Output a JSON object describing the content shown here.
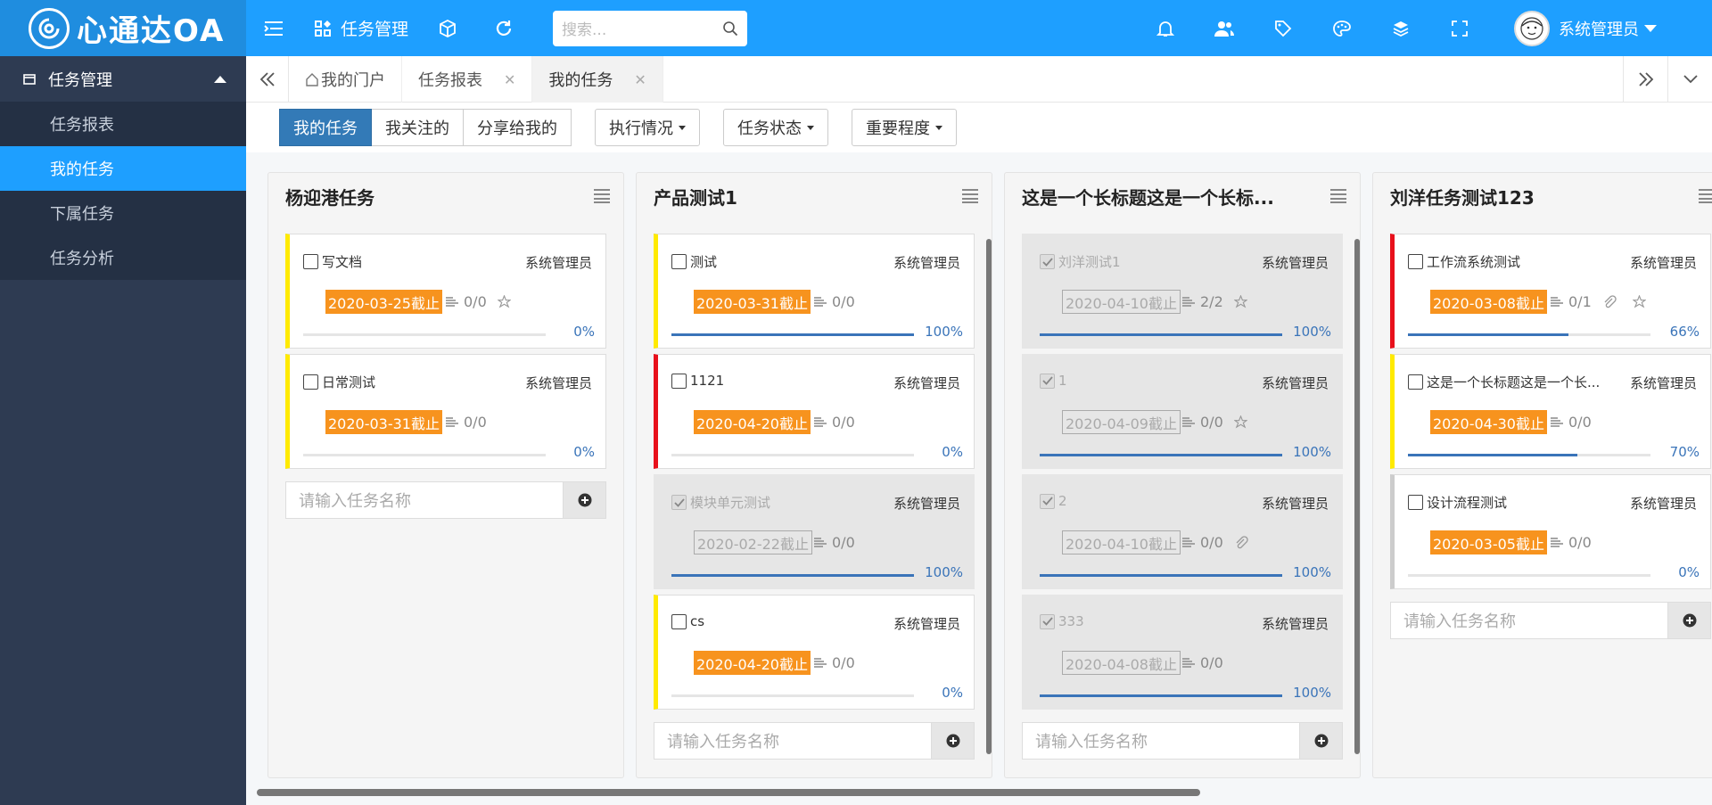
{
  "header": {
    "brand": "心通达OA",
    "module": "任务管理",
    "search_placeholder": "搜索...",
    "user_name": "系统管理员"
  },
  "sidebar": {
    "section": "任务管理",
    "items": [
      {
        "label": "任务报表",
        "active": false
      },
      {
        "label": "我的任务",
        "active": true
      },
      {
        "label": "下属任务",
        "active": false
      },
      {
        "label": "任务分析",
        "active": false
      }
    ]
  },
  "tabs": [
    {
      "label": "我的门户",
      "closable": false,
      "active": false
    },
    {
      "label": "任务报表",
      "closable": true,
      "active": false
    },
    {
      "label": "我的任务",
      "closable": true,
      "active": true
    }
  ],
  "filters": {
    "group": [
      "我的任务",
      "我关注的",
      "分享给我的"
    ],
    "dropdowns": [
      "执行情况",
      "任务状态",
      "重要程度"
    ]
  },
  "columns": [
    {
      "title": "杨迎港任务",
      "cards": [
        {
          "name": "写文档",
          "owner": "系统管理员",
          "due": "2020-03-25截止",
          "subtasks": "0/0",
          "progress": "0%",
          "progress_value": 0,
          "done": false,
          "priority": "yellow",
          "star": true,
          "clip": false
        },
        {
          "name": "日常测试",
          "owner": "系统管理员",
          "due": "2020-03-31截止",
          "subtasks": "0/0",
          "progress": "0%",
          "progress_value": 0,
          "done": false,
          "priority": "yellow",
          "star": false,
          "clip": false
        }
      ],
      "input_placeholder": "请输入任务名称"
    },
    {
      "title": "产品测试1",
      "cards": [
        {
          "name": "测试",
          "owner": "系统管理员",
          "due": "2020-03-31截止",
          "subtasks": "0/0",
          "progress": "100%",
          "progress_value": 100,
          "done": false,
          "priority": "yellow",
          "star": false,
          "clip": false
        },
        {
          "name": "1121",
          "owner": "系统管理员",
          "due": "2020-04-20截止",
          "subtasks": "0/0",
          "progress": "0%",
          "progress_value": 0,
          "done": false,
          "priority": "red",
          "star": false,
          "clip": false
        },
        {
          "name": "模块单元测试",
          "owner": "系统管理员",
          "due": "2020-02-22截止",
          "subtasks": "0/0",
          "progress": "100%",
          "progress_value": 100,
          "done": true,
          "priority": "none",
          "star": false,
          "clip": false
        },
        {
          "name": "cs",
          "owner": "系统管理员",
          "due": "2020-04-20截止",
          "subtasks": "0/0",
          "progress": "0%",
          "progress_value": 0,
          "done": false,
          "priority": "yellow",
          "star": false,
          "clip": false
        }
      ],
      "input_placeholder": "请输入任务名称"
    },
    {
      "title": "这是一个长标题这是一个长标...",
      "cards": [
        {
          "name": "刘洋测试1",
          "owner": "系统管理员",
          "due": "2020-04-10截止",
          "subtasks": "2/2",
          "progress": "100%",
          "progress_value": 100,
          "done": true,
          "priority": "none",
          "star": true,
          "clip": false
        },
        {
          "name": "1",
          "owner": "系统管理员",
          "due": "2020-04-09截止",
          "subtasks": "0/0",
          "progress": "100%",
          "progress_value": 100,
          "done": true,
          "priority": "none",
          "star": true,
          "clip": false
        },
        {
          "name": "2",
          "owner": "系统管理员",
          "due": "2020-04-10截止",
          "subtasks": "0/0",
          "progress": "100%",
          "progress_value": 100,
          "done": true,
          "priority": "none",
          "star": false,
          "clip": true
        },
        {
          "name": "333",
          "owner": "系统管理员",
          "due": "2020-04-08截止",
          "subtasks": "0/0",
          "progress": "100%",
          "progress_value": 100,
          "done": true,
          "priority": "none",
          "star": false,
          "clip": false
        }
      ],
      "input_placeholder": "请输入任务名称"
    },
    {
      "title": "刘洋任务测试123",
      "cards": [
        {
          "name": "工作流系统测试",
          "owner": "系统管理员",
          "due": "2020-03-08截止",
          "subtasks": "0/1",
          "progress": "66%",
          "progress_value": 66,
          "done": false,
          "priority": "red",
          "star": true,
          "clip": true
        },
        {
          "name": "这是一个长标题这是一个长...",
          "owner": "系统管理员",
          "due": "2020-04-30截止",
          "subtasks": "0/0",
          "progress": "70%",
          "progress_value": 70,
          "done": false,
          "priority": "yellow",
          "star": false,
          "clip": false
        },
        {
          "name": "设计流程测试",
          "owner": "系统管理员",
          "due": "2020-03-05截止",
          "subtasks": "0/0",
          "progress": "0%",
          "progress_value": 0,
          "done": false,
          "priority": "gray",
          "star": false,
          "clip": false
        }
      ],
      "input_placeholder": "请输入任务名称"
    }
  ],
  "colors": {
    "topbar": "#1e9fff",
    "sidebar": "#2e3b52",
    "active": "#1e9fff",
    "due_badge": "#f7931e",
    "progress": "#3a74b9"
  }
}
